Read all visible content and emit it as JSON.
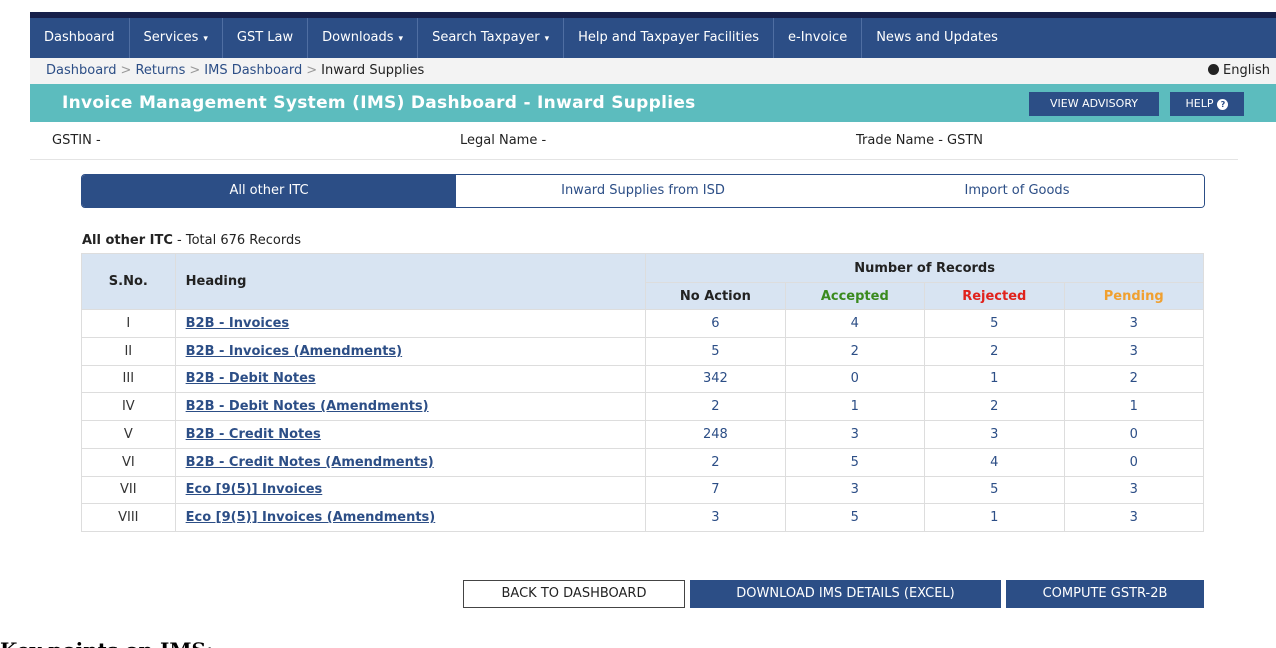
{
  "nav": {
    "items": [
      {
        "label": "Dashboard",
        "caret": false
      },
      {
        "label": "Services",
        "caret": true
      },
      {
        "label": "GST Law",
        "caret": false
      },
      {
        "label": "Downloads",
        "caret": true
      },
      {
        "label": "Search Taxpayer",
        "caret": true
      },
      {
        "label": "Help and Taxpayer Facilities",
        "caret": false
      },
      {
        "label": "e-Invoice",
        "caret": false
      },
      {
        "label": "News and Updates",
        "caret": false
      }
    ]
  },
  "breadcrumb": {
    "items": [
      "Dashboard",
      "Returns",
      "IMS Dashboard"
    ],
    "current": "Inward Supplies",
    "separator": ">",
    "language": "English"
  },
  "header": {
    "title": "Invoice Management System (IMS) Dashboard - Inward Supplies",
    "advisory_label": "VIEW ADVISORY",
    "help_label": "HELP"
  },
  "info": {
    "gstin": "GSTIN -",
    "legal_name": "Legal Name -",
    "trade_name": "Trade Name - GSTN"
  },
  "tabs": [
    {
      "label": "All other ITC",
      "active": true
    },
    {
      "label": "Inward Supplies from ISD",
      "active": false
    },
    {
      "label": "Import of Goods",
      "active": false
    }
  ],
  "records": {
    "section": "All other ITC",
    "summary": " - Total 676 Records"
  },
  "table": {
    "headers": {
      "sno": "S.No.",
      "heading": "Heading",
      "group": "Number of Records",
      "no_action": "No Action",
      "accepted": "Accepted",
      "rejected": "Rejected",
      "pending": "Pending"
    },
    "rows": [
      {
        "sno": "I",
        "heading": "B2B - Invoices",
        "no_action": "6",
        "accepted": "4",
        "rejected": "5",
        "pending": "3"
      },
      {
        "sno": "II",
        "heading": "B2B - Invoices (Amendments)",
        "no_action": "5",
        "accepted": "2",
        "rejected": "2",
        "pending": "3"
      },
      {
        "sno": "III",
        "heading": "B2B - Debit Notes",
        "no_action": "342",
        "accepted": "0",
        "rejected": "1",
        "pending": "2"
      },
      {
        "sno": "IV",
        "heading": "B2B - Debit Notes (Amendments)",
        "no_action": "2",
        "accepted": "1",
        "rejected": "2",
        "pending": "1"
      },
      {
        "sno": "V",
        "heading": "B2B - Credit Notes",
        "no_action": "248",
        "accepted": "3",
        "rejected": "3",
        "pending": "0"
      },
      {
        "sno": "VI",
        "heading": "B2B - Credit Notes (Amendments)",
        "no_action": "2",
        "accepted": "5",
        "rejected": "4",
        "pending": "0"
      },
      {
        "sno": "VII",
        "heading": "Eco [9(5)] Invoices",
        "no_action": "7",
        "accepted": "3",
        "rejected": "5",
        "pending": "3"
      },
      {
        "sno": "VIII",
        "heading": "Eco [9(5)] Invoices (Amendments)",
        "no_action": "3",
        "accepted": "5",
        "rejected": "1",
        "pending": "3"
      }
    ]
  },
  "actions": {
    "back": "BACK TO DASHBOARD",
    "download": "DOWNLOAD IMS DETAILS (EXCEL)",
    "compute": "COMPUTE GSTR-2B"
  },
  "footer": {
    "text": "Key points on IMS:"
  },
  "colors": {
    "navy": "#2c4e86",
    "teal": "#5cbcbe",
    "accepted": "#3a8a1e",
    "rejected": "#e0221c",
    "pending": "#f0a030"
  }
}
